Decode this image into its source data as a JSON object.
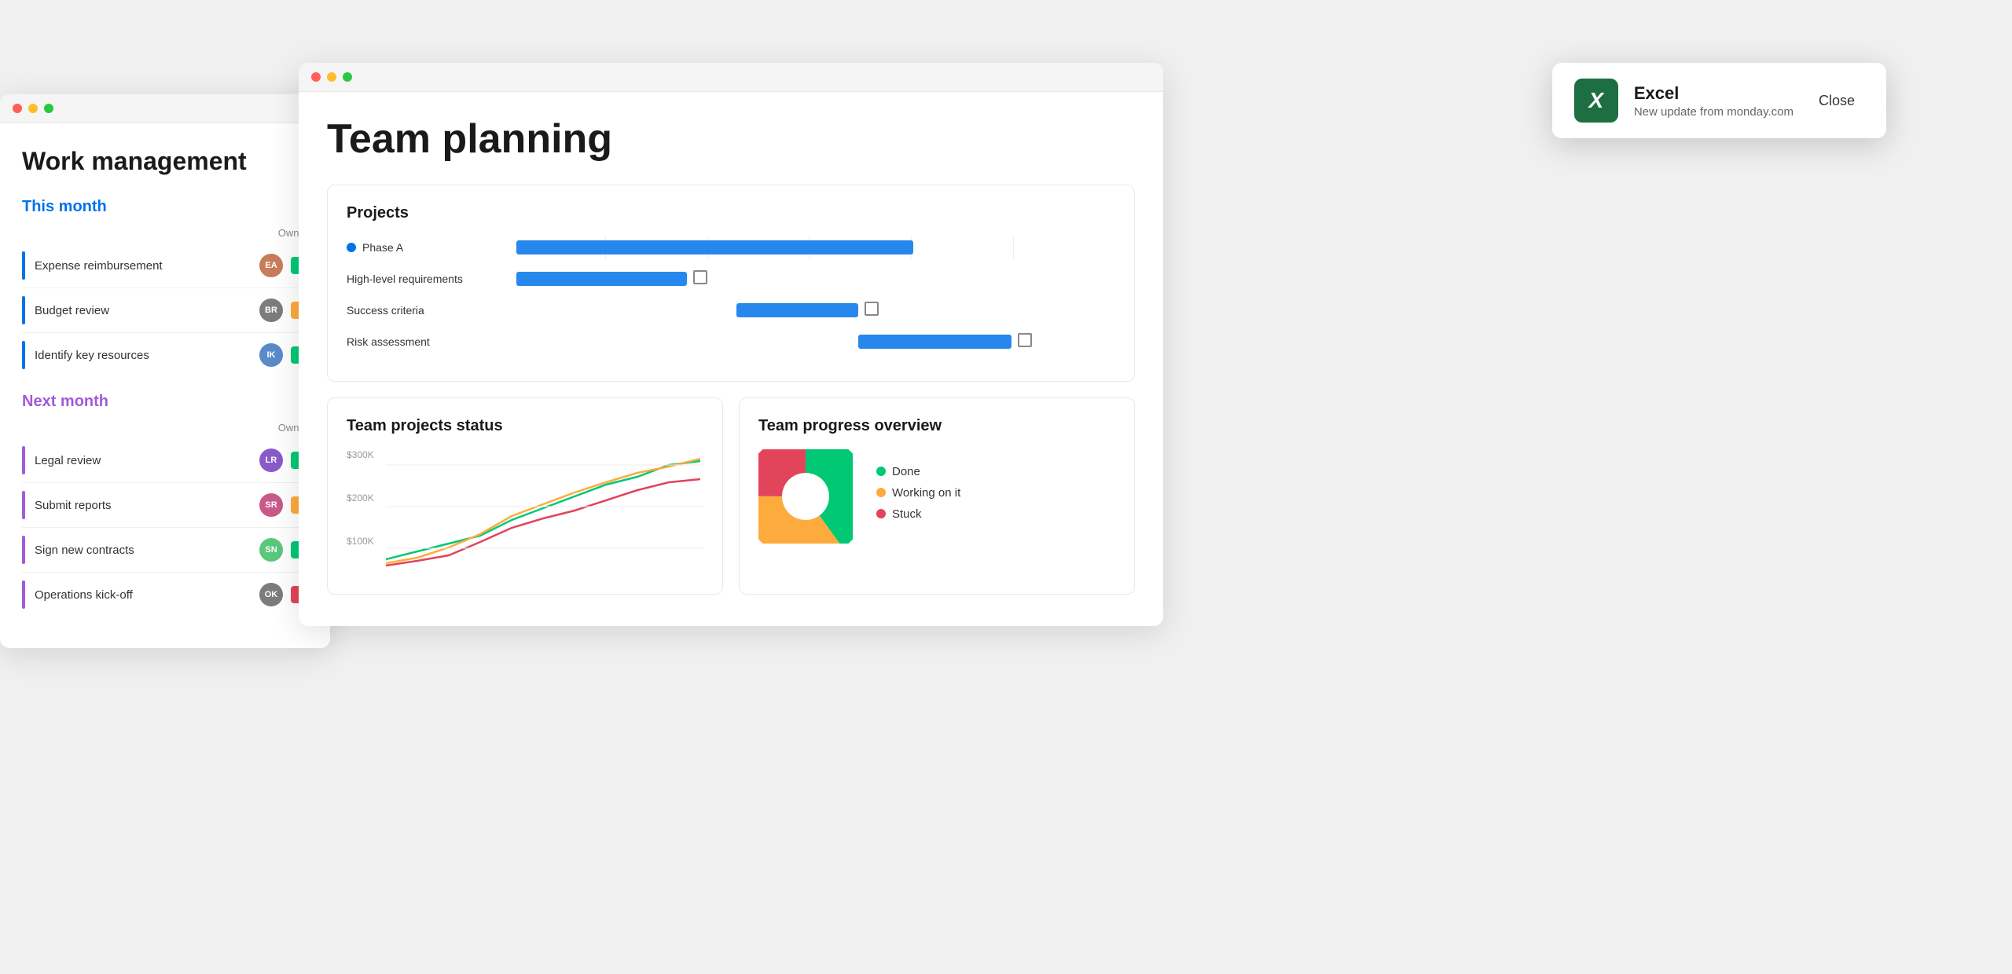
{
  "workWindow": {
    "title": "Work management",
    "thisMonth": {
      "label": "This month",
      "ownerCol": "Owner",
      "tasks": [
        {
          "name": "Expense reimbursement",
          "statusColor": "green"
        },
        {
          "name": "Budget review",
          "statusColor": "orange"
        },
        {
          "name": "Identify key resources",
          "statusColor": "green"
        }
      ]
    },
    "nextMonth": {
      "label": "Next month",
      "ownerCol": "Owner",
      "tasks": [
        {
          "name": "Legal review",
          "statusColor": "green"
        },
        {
          "name": "Submit reports",
          "statusColor": "orange"
        },
        {
          "name": "Sign new contracts",
          "statusColor": "green"
        },
        {
          "name": "Operations kick-off",
          "statusColor": "pink"
        }
      ]
    }
  },
  "teamWindow": {
    "title": "Team planning",
    "projects": {
      "cardTitle": "Projects",
      "rows": [
        {
          "label": "Phase A",
          "isPhase": true
        },
        {
          "label": "High-level requirements",
          "isPhase": false
        },
        {
          "label": "Success criteria",
          "isPhase": false
        },
        {
          "label": "Risk assessment",
          "isPhase": false
        }
      ]
    },
    "statusChart": {
      "cardTitle": "Team projects status",
      "yLabels": [
        "$300K",
        "$200K",
        "$100K"
      ]
    },
    "progressChart": {
      "cardTitle": "Team progress overview",
      "legend": [
        {
          "label": "Done",
          "color": "#00c875"
        },
        {
          "label": "Working on it",
          "color": "#fdab3d"
        },
        {
          "label": "Stuck",
          "color": "#e2445c"
        }
      ]
    }
  },
  "notification": {
    "appName": "Excel",
    "message": "New update from monday.com",
    "closeLabel": "Close"
  }
}
